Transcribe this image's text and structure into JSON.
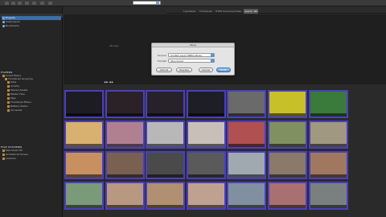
{
  "toolbar": {
    "search_value": "",
    "button_count": 7
  },
  "tabs": [
    {
      "label": "Log Notes"
    },
    {
      "label": "Thumbnail"
    },
    {
      "label": "HTML Summary"
    },
    {
      "label": "Video"
    },
    {
      "label": "Search Tab"
    }
  ],
  "library": {
    "header": "",
    "items": [
      {
        "label": "Projects",
        "selected": true
      },
      {
        "label": "Subprojects",
        "selected": false
      },
      {
        "label": "Bookmarks",
        "selected": false
      }
    ]
  },
  "filters": {
    "title": "FILTERS",
    "items": [
      {
        "label": "Smart Filters"
      },
      {
        "label": "Thumbnail Grouping"
      },
      {
        "label": "Sites"
      },
      {
        "label": "Activity"
      },
      {
        "label": "Shared Assets"
      },
      {
        "label": "Master Files"
      },
      {
        "label": "Tags"
      },
      {
        "label": "Thumbnail Filters"
      },
      {
        "label": "Battery Status"
      },
      {
        "label": "All Assets"
      }
    ]
  },
  "file_systems": {
    "title": "FILE SYSTEMS",
    "items": [
      {
        "label": "Macintosh HD"
      },
      {
        "label": "All External Drives"
      },
      {
        "label": "Volumes"
      }
    ]
  },
  "viewer": {
    "label": "48 clips",
    "controls": "◀  ▶  ◀  ▶"
  },
  "dialog": {
    "title": "Move",
    "rows": [
      {
        "label": "Source:",
        "value": "24 Part Layer MPEG Mixes"
      },
      {
        "label": "Format:",
        "value": "Structured"
      }
    ],
    "buttons": [
      {
        "label": "Add All",
        "default": false
      },
      {
        "label": "Preview",
        "default": false
      },
      {
        "label": "Cancel",
        "default": false
      },
      {
        "label": "Finish",
        "default": true
      }
    ]
  },
  "thumbnails": [
    {
      "label": "",
      "color": "#1c1c22"
    },
    {
      "label": "",
      "color": "#2a2226"
    },
    {
      "label": "",
      "color": "#27222a"
    },
    {
      "label": "",
      "color": "#1e1e26"
    },
    {
      "label": "",
      "color": "#6a6a6a"
    },
    {
      "label": "",
      "color": "#c8c028"
    },
    {
      "label": "",
      "color": "#3a7a3a"
    },
    {
      "label": "",
      "color": "#d8b070"
    },
    {
      "label": "",
      "color": "#b08090"
    },
    {
      "label": "",
      "color": "#b8b8b8"
    },
    {
      "label": "",
      "color": "#c8c0b8"
    },
    {
      "label": "",
      "color": "#b05050"
    },
    {
      "label": "",
      "color": "#809060"
    },
    {
      "label": "",
      "color": "#a09880"
    },
    {
      "label": "",
      "color": "#c89060"
    },
    {
      "label": "",
      "color": "#7a6050"
    },
    {
      "label": "",
      "color": "#4a4a4a"
    },
    {
      "label": "",
      "color": "#5a5a5a"
    },
    {
      "label": "",
      "color": "#a0a8b0"
    },
    {
      "label": "",
      "color": "#8a7a6a"
    },
    {
      "label": "",
      "color": "#a07860"
    },
    {
      "label": "",
      "color": "#7a9a7a"
    },
    {
      "label": "",
      "color": "#b89880"
    },
    {
      "label": "",
      "color": "#b09070"
    },
    {
      "label": "",
      "color": "#c0a090"
    },
    {
      "label": "",
      "color": "#8090a0"
    },
    {
      "label": "",
      "color": "#a87070"
    },
    {
      "label": "",
      "color": "#7a8080"
    }
  ]
}
